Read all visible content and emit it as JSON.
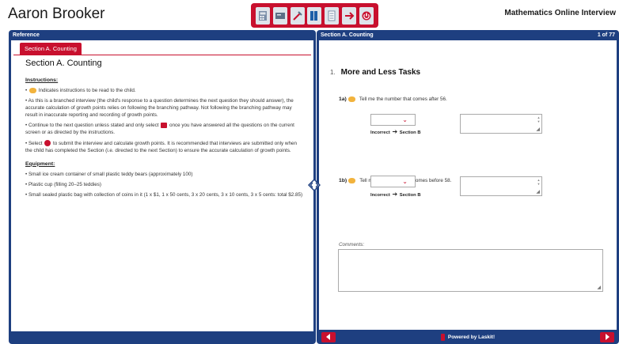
{
  "header": {
    "student_name": "Aaron Brooker",
    "interview_title": "Mathematics Online Interview"
  },
  "toolbar": {
    "items": [
      "calculator-icon",
      "card-icon",
      "tools-icon",
      "book-icon",
      "notes-icon",
      "pointer-icon",
      "submit-icon"
    ],
    "accent": "#c8102e"
  },
  "left_panel": {
    "header": "Reference",
    "tab": "Section A. Counting",
    "title": "Section A. Counting",
    "instructions_heading": "Instructions:",
    "instr1": "Indicates instructions to be read to the child.",
    "instr2": "As this is a branched interview (the child's response to a question determines the next question they should answer), the accurate calculation of growth points relies on following the branching pathway. Not following the branching pathway may result in inaccurate reporting and recording of growth points.",
    "instr3a": "Continue to the next question unless stated and only select",
    "instr3b": "once you have answered all the questions on the current screen or as directed by the instructions.",
    "instr4a": "Select",
    "instr4b": "to submit the interview and calculate growth points. It is recommended that interviews are submitted only when the child has completed the Section (i.e. directed to the next Section) to ensure the accurate calculation of growth points.",
    "equipment_heading": "Equipment:",
    "equip1": "Small ice cream container of small plastic teddy bears (approximately 100)",
    "equip2": "Plastic cup (filling 20–25 teddies)",
    "equip3": "Small sealed plastic bag with collection of coins in it (1 x $1, 1 x 50 cents, 3 x 20 cents, 3 x 10 cents, 3 x 5 cents: total $2.85)"
  },
  "right_panel": {
    "header": "Section A. Counting",
    "page": "1 of 77",
    "question_number": "1.",
    "question_title": "More and Less Tasks",
    "q1_id": "1a)",
    "q1_text": "Tell me the number that comes after 56.",
    "q2_id": "1b)",
    "q2_text": "Tell me the number that comes before 58.",
    "branch_incorrect": "Incorrect",
    "branch_target": "Section B",
    "comments_label": "Comments:",
    "powered_by": "Powered by Laskit!"
  }
}
